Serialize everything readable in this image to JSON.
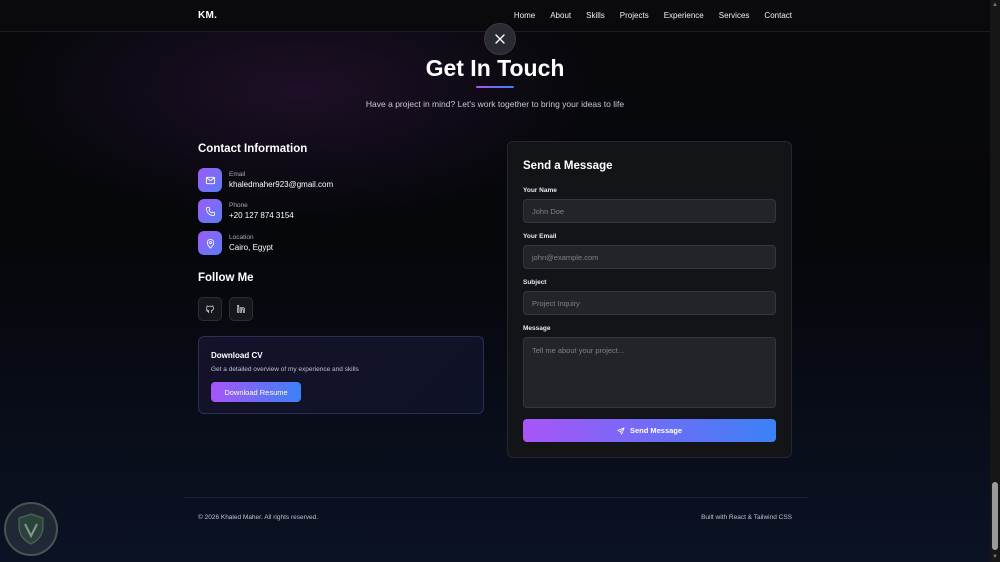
{
  "nav": {
    "logo": "KM.",
    "links": [
      "Home",
      "About",
      "Skills",
      "Projects",
      "Experience",
      "Services",
      "Contact"
    ]
  },
  "header": {
    "title": "Get In Touch",
    "subtitle": "Have a project in mind? Let's work together to bring your ideas to life"
  },
  "contact_info": {
    "title": "Contact Information",
    "items": [
      {
        "label": "Email",
        "value": "khaledmaher923@gmail.com",
        "icon": "mail-icon"
      },
      {
        "label": "Phone",
        "value": "+20 127 874 3154",
        "icon": "phone-icon"
      },
      {
        "label": "Location",
        "value": "Cairo, Egypt",
        "icon": "map-pin-icon"
      }
    ]
  },
  "follow": {
    "title": "Follow Me",
    "socials": [
      "github-icon",
      "linkedin-icon"
    ]
  },
  "cv": {
    "title": "Download CV",
    "description": "Get a detailed overview of my experience and skills",
    "button": "Download Resume"
  },
  "form": {
    "title": "Send a Message",
    "name_label": "Your Name",
    "name_placeholder": "John Doe",
    "email_label": "Your Email",
    "email_placeholder": "john@example.com",
    "subject_label": "Subject",
    "subject_placeholder": "Project Inquiry",
    "message_label": "Message",
    "message_placeholder": "Tell me about your project...",
    "submit": "Send Message"
  },
  "footer": {
    "copyright": "© 2026 Khaled Maher. All rights reserved.",
    "built_with": "Built with React & Tailwind CSS"
  },
  "colors": {
    "accent_start": "#a855f7",
    "accent_end": "#3b82f6",
    "background": "#08080c"
  }
}
